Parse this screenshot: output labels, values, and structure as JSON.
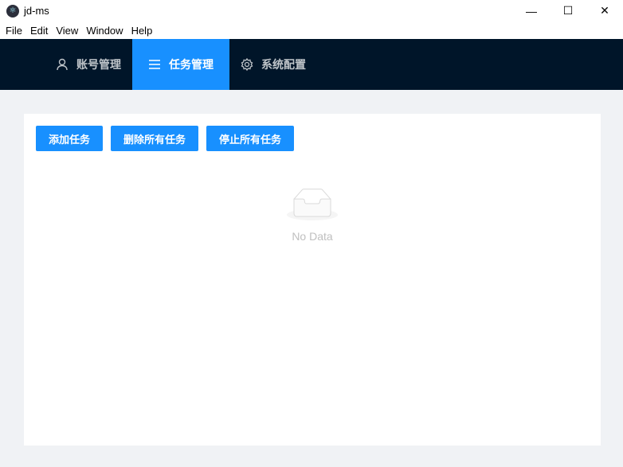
{
  "window": {
    "title": "jd-ms",
    "minimize": "—",
    "maximize": "☐",
    "close": "✕"
  },
  "menu": [
    "File",
    "Edit",
    "View",
    "Window",
    "Help"
  ],
  "nav": [
    {
      "label": "账号管理",
      "icon": "user-icon"
    },
    {
      "label": "任务管理",
      "icon": "menu-icon",
      "active": true
    },
    {
      "label": "系统配置",
      "icon": "gear-icon"
    }
  ],
  "toolbar": {
    "add": "添加任务",
    "delete_all": "删除所有任务",
    "stop_all": "停止所有任务"
  },
  "empty": {
    "text": "No Data"
  },
  "colors": {
    "primary": "#1890ff",
    "nav_bg": "#001529"
  }
}
